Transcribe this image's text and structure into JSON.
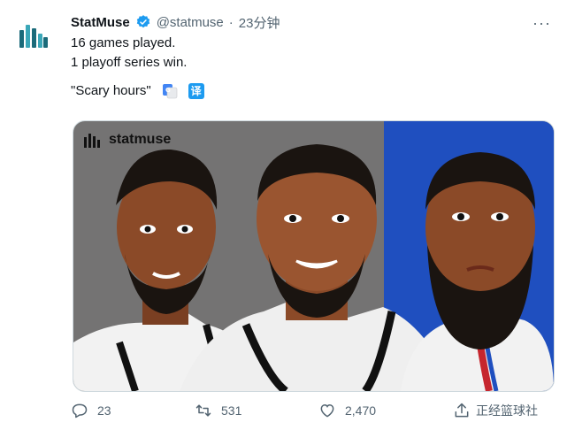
{
  "account": {
    "display_name": "StatMuse",
    "handle": "@statmuse",
    "separator": "·",
    "time": "23分钟",
    "verified_icon": "verified-badge-icon",
    "avatar_icon": "statmuse-logo-icon"
  },
  "tweet": {
    "line1": "16 games played.",
    "line2": "1 playoff series win.",
    "line3": "\"Scary hours\"",
    "translate_label": "译"
  },
  "media": {
    "logo_text": "statmuse",
    "description_colors": {
      "left_bg": "#747373",
      "right_bg": "#1f4fbf"
    }
  },
  "actions": {
    "reply_count": "23",
    "retweet_count": "531",
    "like_count": "2,470"
  },
  "watermark": "正经篮球社",
  "colors": {
    "accent": "#1d9bf0",
    "secondary_text": "#536471"
  }
}
